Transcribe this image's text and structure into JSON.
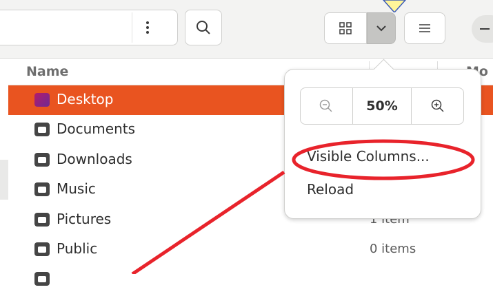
{
  "header": {
    "path_menu_icon": "vertical-dots-icon",
    "search_icon": "search-icon",
    "grid_view_icon": "grid-view-icon",
    "view_options_icon": "chevron-down-icon",
    "list_view_icon": "list-view-icon"
  },
  "columns": {
    "name": "Name",
    "modified": "Mo"
  },
  "files": [
    {
      "name": "Desktop",
      "size": "",
      "selected": true
    },
    {
      "name": "Documents",
      "size": ""
    },
    {
      "name": "Downloads",
      "size": ""
    },
    {
      "name": "Music",
      "size": ""
    },
    {
      "name": "Pictures",
      "size": "1 item"
    },
    {
      "name": "Public",
      "size": "0 items"
    }
  ],
  "popover": {
    "zoom_level": "50%",
    "zoom_out_icon": "zoom-out-icon",
    "zoom_in_icon": "zoom-in-icon",
    "visible_columns": "Visible Columns...",
    "reload": "Reload"
  },
  "colors": {
    "accent": "#e95420",
    "annotation": "#e8232b",
    "marker": "#fff59a"
  }
}
